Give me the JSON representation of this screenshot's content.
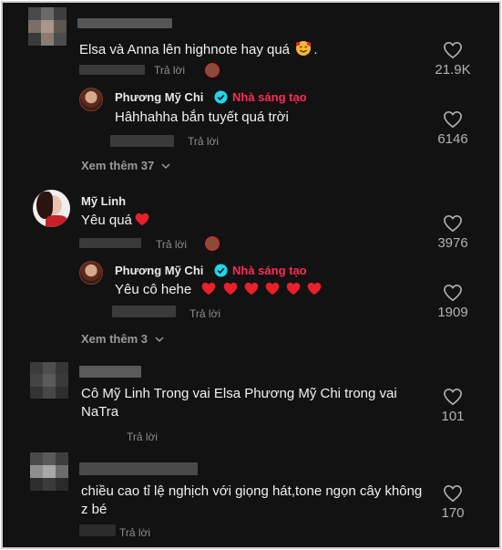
{
  "comments": [
    {
      "text": "Elsa và Anna lên highnote hay quá",
      "emoji": "smiling-face-with-hearts",
      "suffix": ".",
      "reply_label": "Trả lời",
      "likes": "21.9K",
      "reply": {
        "author": "Phương Mỹ Chi",
        "badge": "Nhà sáng tạo",
        "text": "Hâhhahha bắn tuyết quá trời",
        "reply_label": "Trả lời",
        "likes": "6146"
      },
      "view_more": "Xem thêm 37"
    },
    {
      "author": "Mỹ Linh",
      "text": "Yêu quá",
      "reply_label": "Trả lời",
      "likes": "3976",
      "reply": {
        "author": "Phương Mỹ Chi",
        "badge": "Nhà sáng tạo",
        "text": "Yêu cô hehe",
        "reply_label": "Trả lời",
        "likes": "1909"
      },
      "view_more": "Xem thêm 3"
    },
    {
      "text": "Cô Mỹ Linh Trong vai Elsa Phương Mỹ Chi trong vai NaTra",
      "reply_label": "Trả lời",
      "likes": "101"
    },
    {
      "text": "chiều cao tỉ lệ nghịch với giọng hát,tone ngọn cây không z bé",
      "reply_label": "Trả lời",
      "likes": "170"
    }
  ],
  "colors": {
    "background": "#121212",
    "creator_badge": "#fe2c55",
    "verified": "#20d5ec",
    "heart_emoji": "#e8202a"
  },
  "icons": {
    "like": "heart-outline-icon",
    "verified": "verified-check-icon",
    "expand": "chevron-down-icon"
  }
}
